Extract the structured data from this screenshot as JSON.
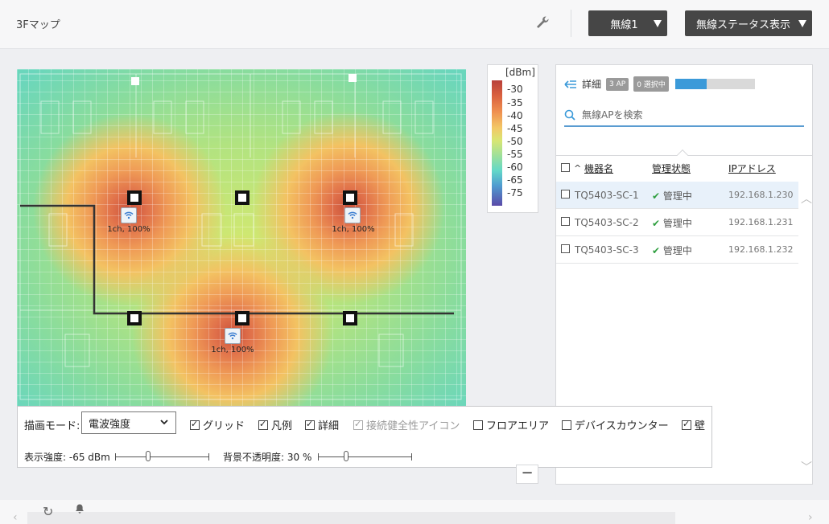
{
  "header": {
    "title": "3Fマップ",
    "wireless_select": "無線1",
    "status_select": "無線ステータス表示"
  },
  "legend": {
    "unit": "[dBm]",
    "ticks": [
      "-30",
      "-35",
      "-40",
      "-45",
      "-50",
      "-55",
      "-60",
      "-65",
      "-75"
    ]
  },
  "map": {
    "aps": [
      {
        "label": "1ch, 100%"
      },
      {
        "label": "1ch, 100%"
      },
      {
        "label": "1ch, 100%"
      }
    ]
  },
  "panel": {
    "detail_label": "詳細",
    "ap_count_badge": "3 AP",
    "selected_badge": "0 選択中",
    "progress_fraction": 0.4,
    "search_placeholder": "無線APを検索",
    "columns": {
      "name": "機器名",
      "status": "管理状態",
      "ip": "IPアドレス"
    },
    "sort_indicator": "^",
    "rows": [
      {
        "name": "TQ5403-SC-1",
        "status": "管理中",
        "ip": "192.168.1.230",
        "selected": true
      },
      {
        "name": "TQ5403-SC-2",
        "status": "管理中",
        "ip": "192.168.1.231",
        "selected": false
      },
      {
        "name": "TQ5403-SC-3",
        "status": "管理中",
        "ip": "192.168.1.232",
        "selected": false
      }
    ]
  },
  "controls": {
    "mode_label": "描画モード:",
    "mode_value": "電波強度",
    "checkboxes": {
      "grid": "グリッド",
      "legend": "凡例",
      "detail": "詳細",
      "health_icon": "接続健全性アイコン",
      "floor_area": "フロアエリア",
      "device_counter": "デバイスカウンター",
      "wall": "壁"
    },
    "strength_label": "表示強度: -65 dBm",
    "strength_fraction": 0.35,
    "opacity_label": "背景不透明度: 30 %",
    "opacity_fraction": 0.3
  },
  "zoom_out": "−",
  "colors": {
    "accent": "#3b9ad9",
    "check_green": "#2e9e3f",
    "button_dark": "#464646"
  }
}
